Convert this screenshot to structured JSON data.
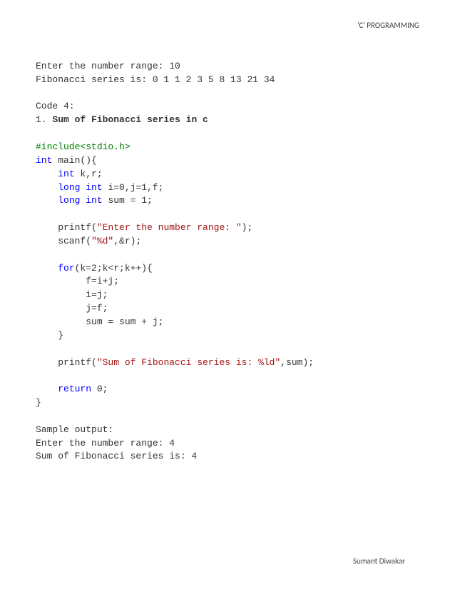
{
  "header": "'C' PROGRAMMING",
  "intro": {
    "l1": "Enter the number range: 10",
    "l2": "Fibonacci series is: 0 1 1 2 3 5 8 13 21 34"
  },
  "section": {
    "label": "Code 4:",
    "num": "1. ",
    "title": "Sum of Fibonacci series in c"
  },
  "code": {
    "include": "#include<stdio.h>",
    "kw_int": "int",
    "main_open": " main(){",
    "decl1": " k,r;",
    "kw_long_int": "long int",
    "decl2": " i=0,j=1,f;",
    "decl3": " sum = 1;",
    "printf1a": "    printf(",
    "printf1s": "\"Enter the number range: \"",
    "printf1b": ");",
    "scanf1a": "    scanf(",
    "scanf1s": "\"%d\"",
    "scanf1b": ",&r);",
    "kw_for": "for",
    "for_rest": "(k=2;k<r;k++){",
    "body1": "         f=i+j;",
    "body2": "         i=j;",
    "body3": "         j=f;",
    "body4": "         sum = sum + j;",
    "close_brace": "    }",
    "printf2a": "    printf(",
    "printf2s": "\"Sum of Fibonacci series is: %ld\"",
    "printf2b": ",sum);",
    "kw_return": "return",
    "return_rest": " 0;",
    "end_brace": "}",
    "pad4": "    "
  },
  "output": {
    "l1": "Sample output:",
    "l2": "Enter the number range: 4",
    "l3": "Sum of Fibonacci series is: 4"
  },
  "footer": "Sumant Diwakar"
}
